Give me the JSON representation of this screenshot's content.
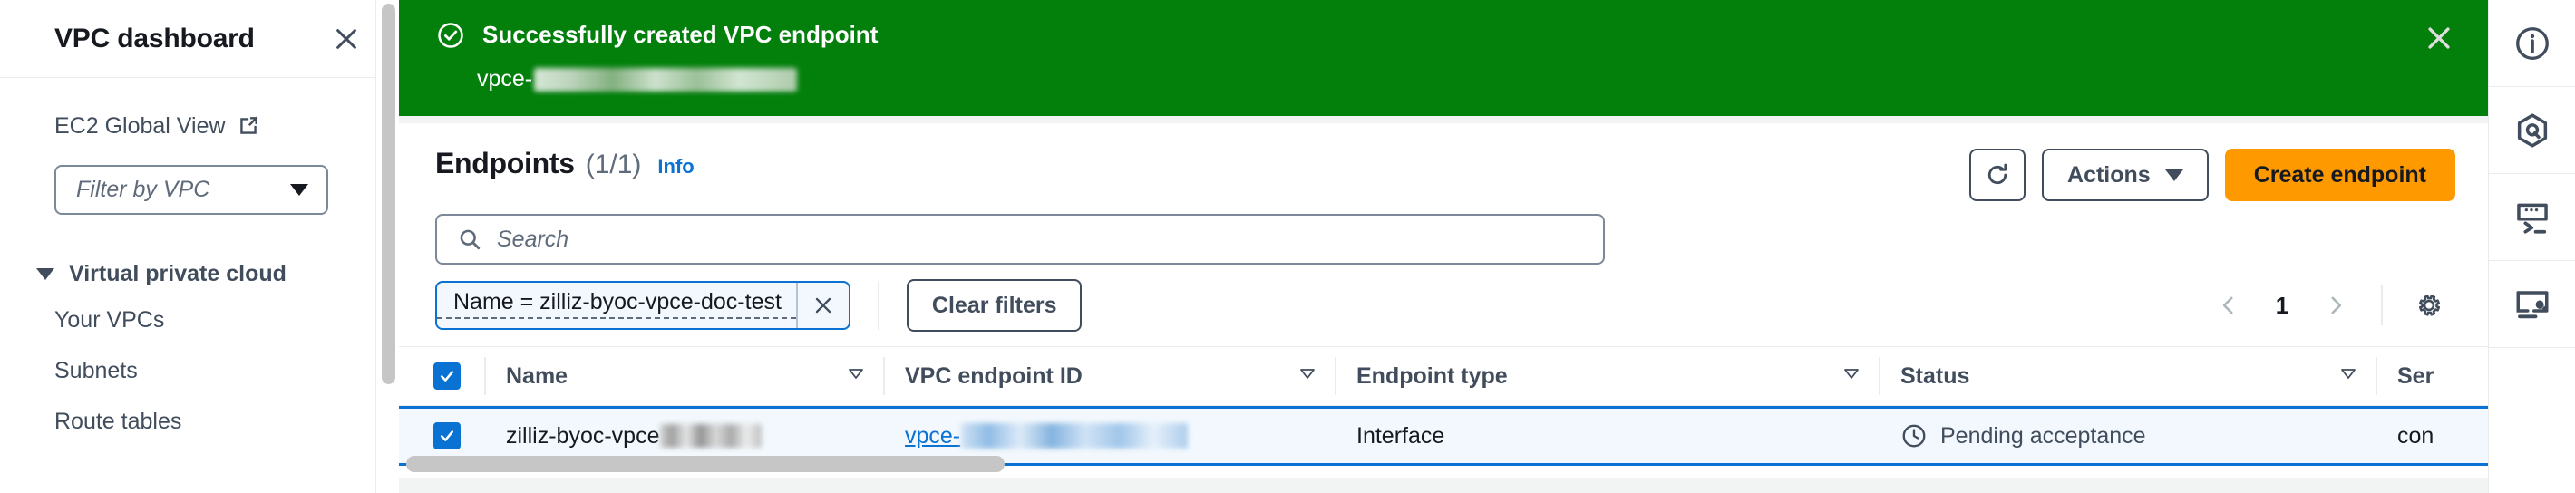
{
  "sidebar": {
    "title": "VPC dashboard",
    "close_icon": "close-icon",
    "global_view": {
      "label": "EC2 Global View",
      "icon": "external-link-icon"
    },
    "vpc_filter": {
      "placeholder": "Filter by VPC",
      "value": ""
    },
    "nav_group": {
      "label": "Virtual private cloud",
      "expanded": true
    },
    "nav_items": [
      {
        "label": "Your VPCs"
      },
      {
        "label": "Subnets"
      },
      {
        "label": "Route tables"
      }
    ]
  },
  "flashbar": {
    "type": "success",
    "icon": "check-circle-icon",
    "title": "Successfully created VPC endpoint",
    "detail_prefix": "vpce-",
    "detail_redacted": true,
    "close_icon": "close-icon",
    "background_color": "#037f0c"
  },
  "content": {
    "title": "Endpoints",
    "count": "(1/1)",
    "info_link": "Info",
    "actions": {
      "refresh_icon": "refresh-icon",
      "actions_label": "Actions",
      "actions_caret_icon": "chevron-down-icon",
      "create_label": "Create endpoint",
      "create_color": "#ff9900"
    },
    "search": {
      "placeholder": "Search",
      "value": "",
      "icon": "search-icon"
    },
    "filter_token": {
      "label": "Name = zilliz-byoc-vpce-doc-test",
      "remove_icon": "close-icon"
    },
    "clear_filters_label": "Clear filters",
    "pagination": {
      "prev_icon": "chevron-left-icon",
      "page": "1",
      "next_icon": "chevron-right-icon",
      "settings_icon": "gear-icon"
    },
    "table": {
      "select_all_checked": true,
      "columns": [
        {
          "label": "Name",
          "sortable": true
        },
        {
          "label": "VPC endpoint ID",
          "sortable": true
        },
        {
          "label": "Endpoint type",
          "sortable": true
        },
        {
          "label": "Status",
          "sortable": true
        },
        {
          "label": "Ser",
          "sortable": false,
          "truncated": true
        }
      ],
      "rows": [
        {
          "selected": true,
          "name": "zilliz-byoc-vpce",
          "name_redacted": true,
          "vpc_endpoint_id": "vpce-",
          "vpc_endpoint_id_redacted": true,
          "endpoint_type": "Interface",
          "status": "Pending acceptance",
          "status_icon": "clock-icon",
          "service_name": "con"
        }
      ]
    }
  },
  "rail": {
    "items": [
      {
        "icon": "info-circle-icon",
        "name": "help-panel"
      },
      {
        "icon": "amazon-q-icon",
        "name": "amazon-q"
      },
      {
        "icon": "cloudshell-icon",
        "name": "cloudshell"
      },
      {
        "icon": "troubleshoot-monitor-icon",
        "name": "troubleshoot"
      }
    ]
  }
}
